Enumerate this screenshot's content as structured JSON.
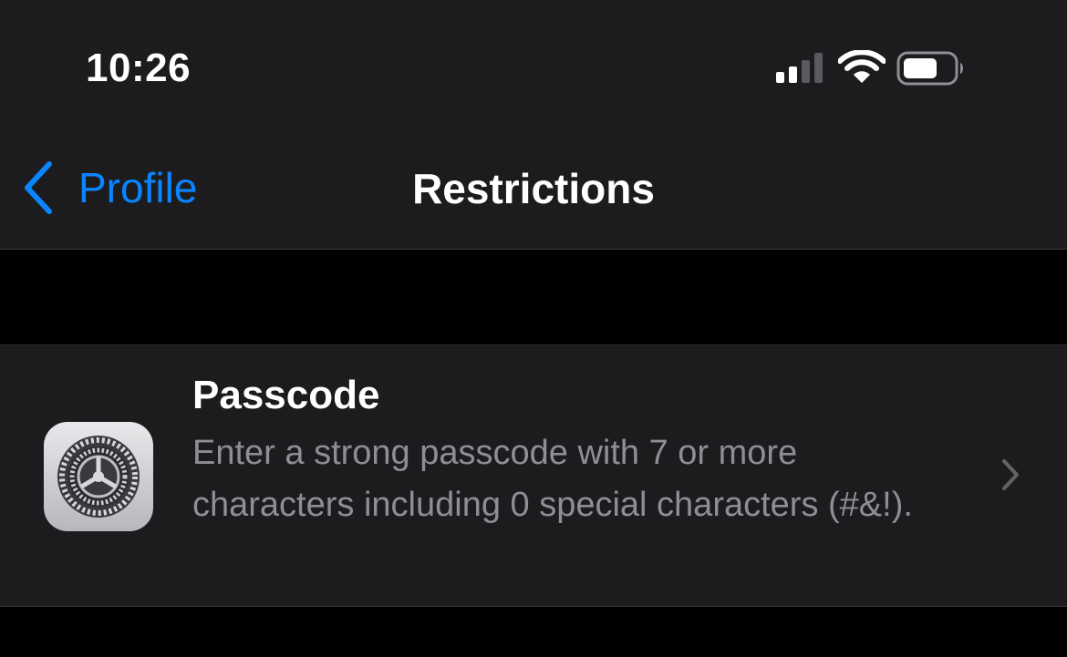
{
  "status_bar": {
    "time": "10:26",
    "icons": [
      "cellular-signal-icon",
      "wifi-icon",
      "battery-icon"
    ]
  },
  "nav": {
    "back_label": "Profile",
    "title": "Restrictions"
  },
  "rows": [
    {
      "icon": "settings-gear-icon",
      "title": "Passcode",
      "subtitle": "Enter a strong passcode with 7 or more characters including 0 special characters (#&!)."
    }
  ],
  "colors": {
    "accent": "#0a84ff",
    "background": "#000000",
    "surface": "#1c1c1e",
    "secondary_text": "#8e8e93"
  }
}
